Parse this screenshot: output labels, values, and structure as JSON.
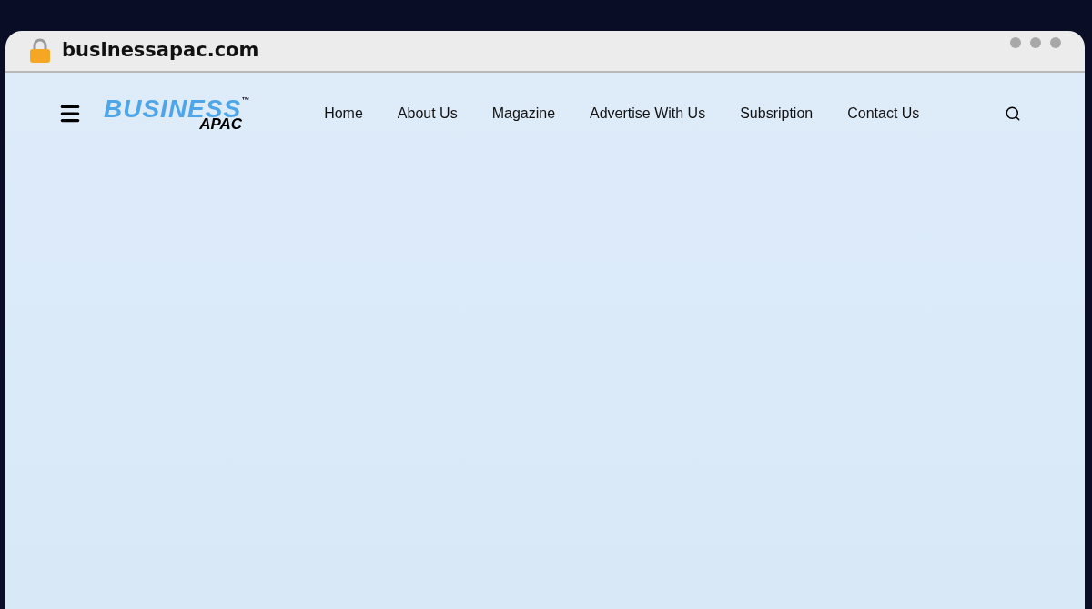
{
  "browser": {
    "url": "businessapac.com"
  },
  "header": {
    "logo": {
      "main": "BUSINESS",
      "trademark": "™",
      "sub": "APAC"
    },
    "nav": [
      "Home",
      "About Us",
      "Magazine",
      "Advertise With Us",
      "Subsription",
      "Contact Us"
    ]
  }
}
